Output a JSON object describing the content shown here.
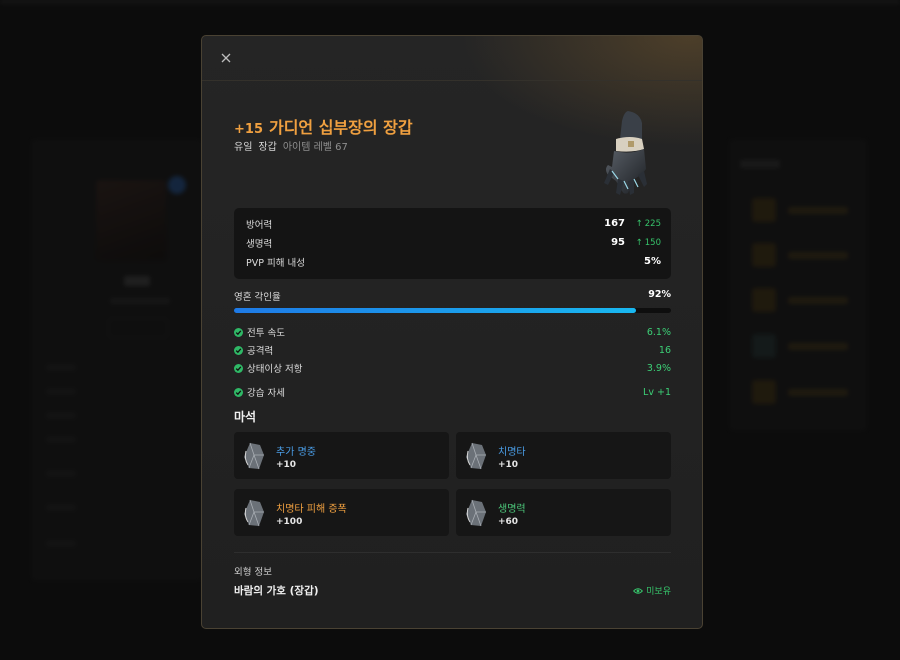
{
  "modal": {
    "close_icon": "close-icon"
  },
  "item": {
    "enhancement": "+15",
    "name": "가디언 십부장의 장갑",
    "grade": "유일",
    "slot": "장갑",
    "item_level": "아이템 레벨 67",
    "image_icon": "gauntlet-icon",
    "colors": {
      "title": "#f0a040",
      "positive": "#36c26a"
    }
  },
  "stats": [
    {
      "label": "방어력",
      "value": "167",
      "diff": "225"
    },
    {
      "label": "생명력",
      "value": "95",
      "diff": "150"
    },
    {
      "label": "PVP 피해 내성",
      "value": "5%",
      "diff": ""
    }
  ],
  "soul": {
    "label": "영혼 각인율",
    "value_text": "92%",
    "progress": 0.92,
    "bar_colors": [
      "#1e7ae6",
      "#19b8f0"
    ]
  },
  "bonuses": [
    {
      "label": "전투 속도",
      "value": "6.1%"
    },
    {
      "label": "공격력",
      "value": "16"
    },
    {
      "label": "상태이상 저항",
      "value": "3.9%"
    },
    {
      "label": "강습 자세",
      "value": "Lv +1"
    }
  ],
  "gems": {
    "title": "마석",
    "items": [
      {
        "name": "추가 명중",
        "amount": "+10",
        "color": "#4a9de6"
      },
      {
        "name": "치명타",
        "amount": "+10",
        "color": "#4a9de6"
      },
      {
        "name": "치명타 피해 증폭",
        "amount": "+100",
        "color": "#f0a040"
      },
      {
        "name": "생명력",
        "amount": "+60",
        "color": "#4cc77a"
      }
    ]
  },
  "appearance": {
    "label": "외형 정보",
    "name": "바람의 가호 (장갑)",
    "status": "미보유",
    "status_icon": "eye-icon"
  }
}
